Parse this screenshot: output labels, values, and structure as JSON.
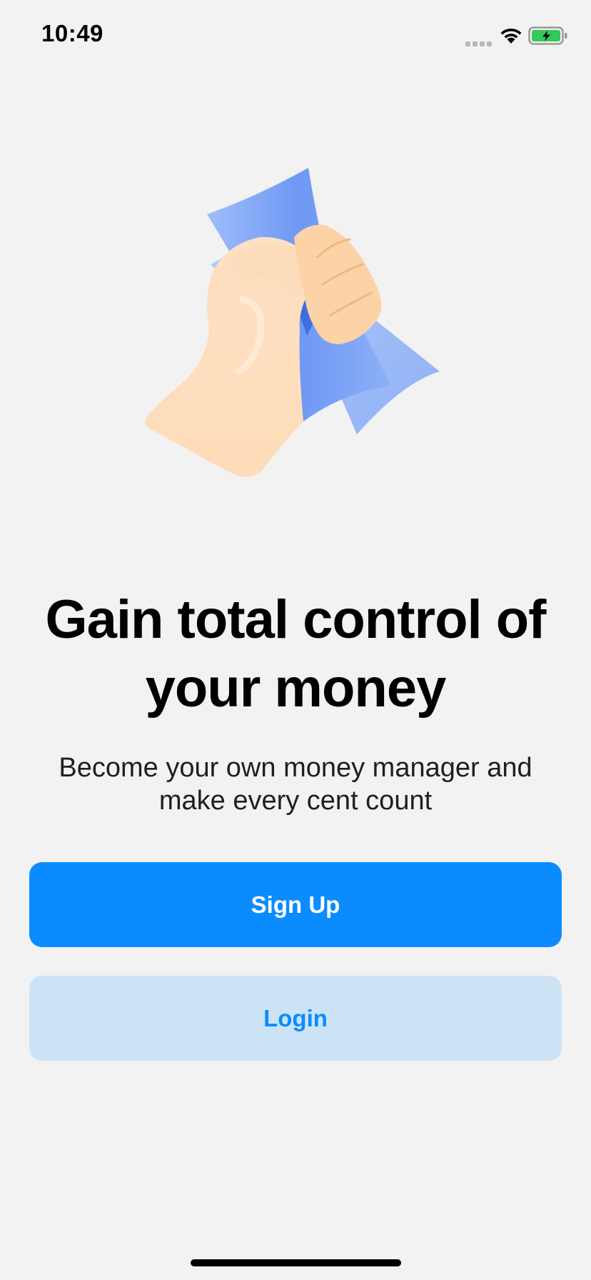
{
  "status_bar": {
    "time": "10:49",
    "icons": [
      "cellular-signal-icon",
      "wifi-icon",
      "battery-charging-icon"
    ]
  },
  "hero": {
    "icon": "hand-holding-money-icon"
  },
  "headline": "Gain total control of your money",
  "subtitle": "Become your own money manager and make every cent count",
  "buttons": {
    "signup_label": "Sign Up",
    "login_label": "Login"
  },
  "colors": {
    "background": "#f2f2f2",
    "primary": "#0a8cff",
    "secondary_bg": "#cce3f6",
    "battery_green": "#34c759"
  }
}
